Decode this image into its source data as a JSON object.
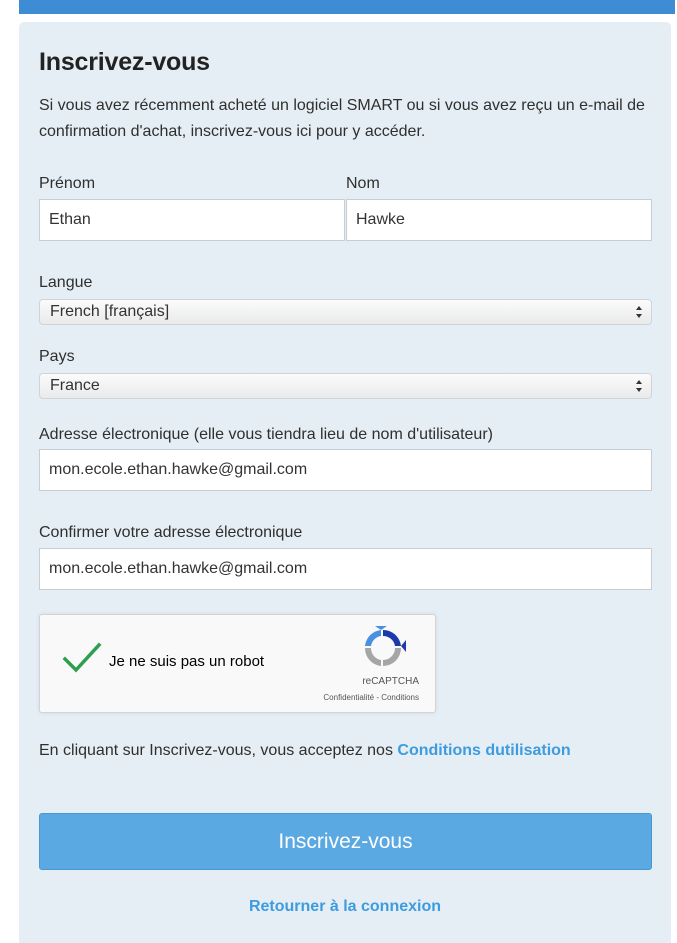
{
  "form": {
    "title": "Inscrivez-vous",
    "intro": "Si vous avez récemment acheté un logiciel SMART ou si vous avez reçu un e-mail de confirmation d'achat, inscrivez-vous ici pour y accéder.",
    "first_name": {
      "label": "Prénom",
      "value": "Ethan"
    },
    "last_name": {
      "label": "Nom",
      "value": "Hawke"
    },
    "language": {
      "label": "Langue",
      "selected": "French [français]"
    },
    "country": {
      "label": "Pays",
      "selected": "France"
    },
    "email": {
      "label": "Adresse électronique (elle vous tiendra lieu de nom d'utilisateur)",
      "value": "mon.ecole.ethan.hawke@gmail.com"
    },
    "email_confirm": {
      "label": "Confirmer votre adresse électronique",
      "value": "mon.ecole.ethan.hawke@gmail.com"
    },
    "captcha": {
      "label": "Je ne suis pas un robot",
      "brand": "reCAPTCHA",
      "links": "Confidentialité - Conditions",
      "checked": true,
      "check_color": "#2e9e4f"
    },
    "terms": {
      "text": "En cliquant sur Inscrivez-vous, vous acceptez nos ",
      "link": "Conditions dutilisation"
    },
    "submit_label": "Inscrivez-vous",
    "back_link": "Retourner à la connexion"
  },
  "colors": {
    "header_bar": "#3e8dd4",
    "panel_bg": "#e5eef4",
    "button": "#5aa9e2",
    "link": "#3d9be0"
  },
  "icons": [
    "checkmark-icon",
    "recaptcha-logo-icon",
    "select-arrows-icon"
  ]
}
